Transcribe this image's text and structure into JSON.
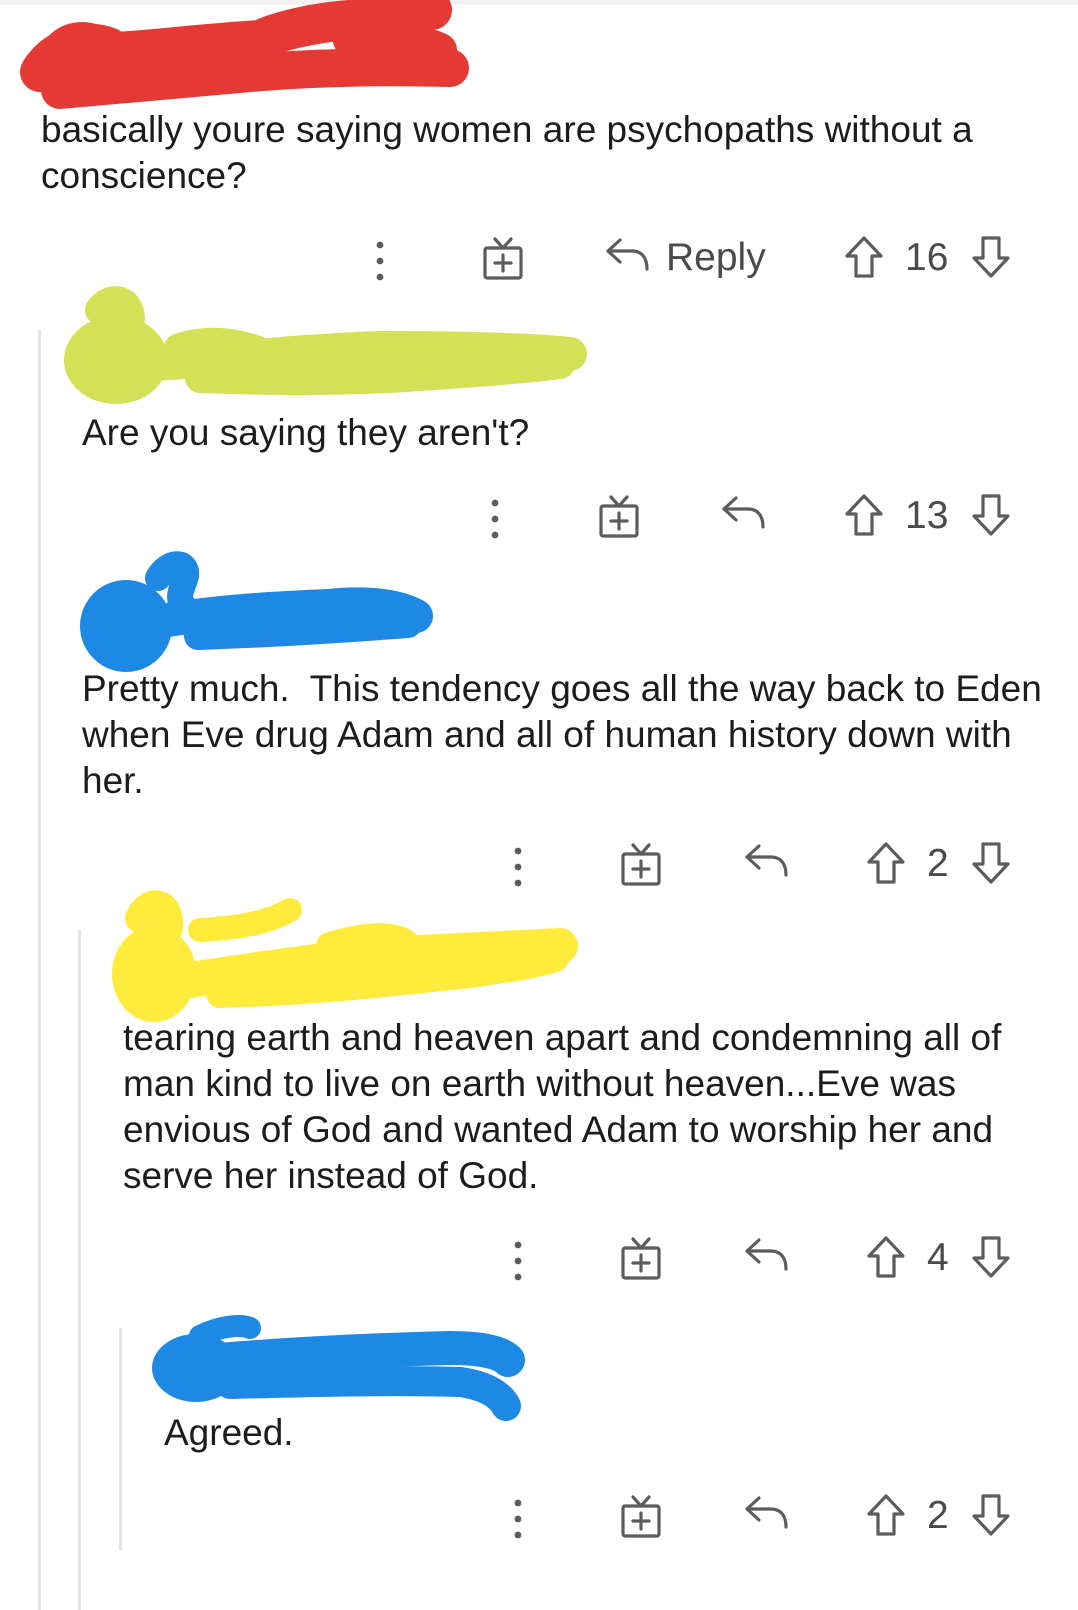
{
  "comments": [
    {
      "text": "basically youre saying women are psychopaths without a conscience?",
      "score": "16",
      "reply_label": "Reply",
      "redaction_color": "#e53935"
    },
    {
      "text": "Are you saying they aren't?",
      "score": "13",
      "redaction_color": "#d4e157"
    },
    {
      "text": "Pretty much.  This tendency goes all the way back to Eden when Eve drug Adam and all of human history down with her.",
      "score": "2",
      "redaction_color": "#1e88e5"
    },
    {
      "text": "tearing earth and heaven apart and condemning all of man kind to live on earth without heaven...Eve was envious of God and wanted Adam to worship her and serve her instead of God.",
      "score": "4",
      "redaction_color": "#ffeb3b"
    },
    {
      "text": "Agreed.",
      "score": "2",
      "redaction_color": "#1e88e5"
    }
  ],
  "icons": {
    "more": "more-vertical-icon",
    "award": "gift-award-icon",
    "reply": "reply-arrow-icon",
    "upvote": "upvote-arrow-icon",
    "downvote": "downvote-arrow-icon"
  },
  "colors": {
    "background": "#ffffff",
    "text": "#1c1c1c",
    "icon": "#5c5c5c",
    "thread_line": "#e4e4e4"
  }
}
